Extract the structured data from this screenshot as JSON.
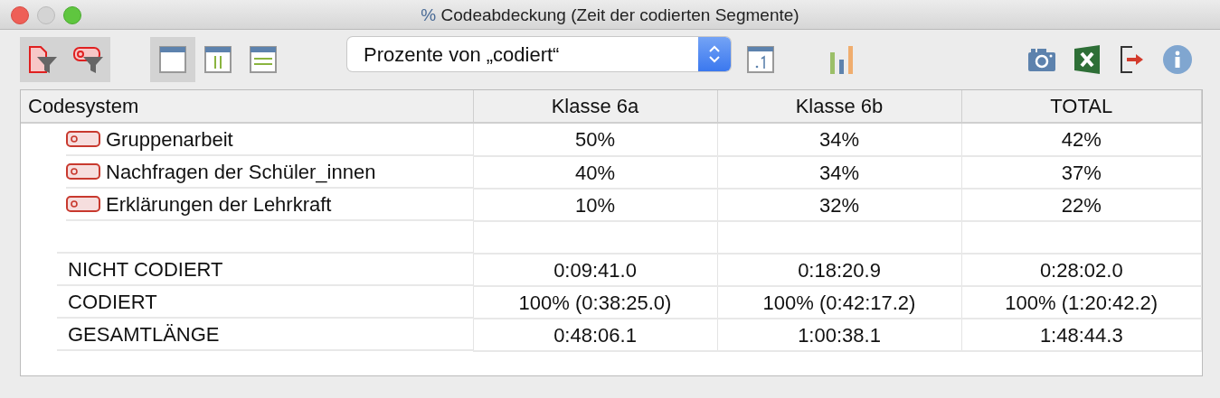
{
  "window": {
    "title_icon": "%",
    "title": "Codeabdeckung (Zeit der codierten Segmente)"
  },
  "toolbar": {
    "filters": [
      {
        "kind": "document-filter",
        "active": true
      },
      {
        "kind": "code-filter",
        "active": true
      }
    ],
    "views": [
      {
        "kind": "full",
        "selected": true
      },
      {
        "kind": "columns",
        "selected": false
      },
      {
        "kind": "rows",
        "selected": false
      }
    ],
    "dropdown": {
      "value": "Prozente von „codiert“"
    },
    "tools": [
      {
        "kind": "decimal"
      },
      {
        "kind": "chart"
      }
    ],
    "actions": [
      {
        "kind": "camera"
      },
      {
        "kind": "excel"
      },
      {
        "kind": "export"
      },
      {
        "kind": "info"
      }
    ]
  },
  "table": {
    "columns": [
      "Codesystem",
      "Klasse 6a",
      "Klasse 6b",
      "TOTAL"
    ],
    "code_rows": [
      {
        "label": "Gruppenarbeit",
        "values": [
          "50%",
          "34%",
          "42%"
        ]
      },
      {
        "label": "Nachfragen der Schüler_innen",
        "values": [
          "40%",
          "34%",
          "37%"
        ]
      },
      {
        "label": "Erklärungen der Lehrkraft",
        "values": [
          "10%",
          "32%",
          "22%"
        ]
      }
    ],
    "summary_rows": [
      {
        "label": "NICHT CODIERT",
        "values": [
          "0:09:41.0",
          "0:18:20.9",
          "0:28:02.0"
        ]
      },
      {
        "label": "CODIERT",
        "values": [
          "100% (0:38:25.0)",
          "100% (0:42:17.2)",
          "100% (1:20:42.2)"
        ]
      },
      {
        "label": "GESAMTLÄNGE",
        "values": [
          "0:48:06.1",
          "1:00:38.1",
          "1:48:44.3"
        ]
      }
    ]
  }
}
